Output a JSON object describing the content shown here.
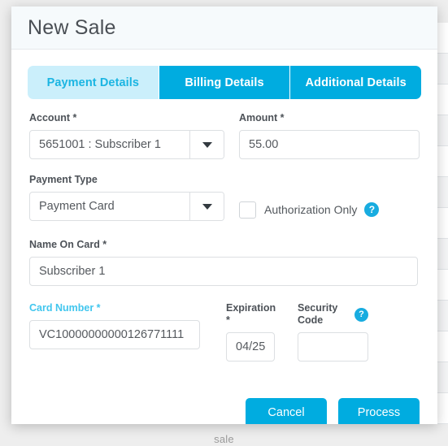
{
  "background": {
    "footer_label": "sale",
    "rows": 13
  },
  "modal": {
    "title": "New Sale",
    "tabs": [
      {
        "label": "Payment Details",
        "active": true
      },
      {
        "label": "Billing Details",
        "active": false
      },
      {
        "label": "Additional Details",
        "active": false
      }
    ],
    "fields": {
      "account": {
        "label": "Account *",
        "value": "5651001 : Subscriber 1"
      },
      "amount": {
        "label": "Amount *",
        "value": "55.00"
      },
      "payment_type": {
        "label": "Payment Type",
        "value": "Payment Card"
      },
      "authorization_only": {
        "label": "Authorization Only",
        "checked": false,
        "help_glyph": "?"
      },
      "name_on_card": {
        "label": "Name On Card *",
        "value": "Subscriber 1"
      },
      "card_number": {
        "label": "Card Number *",
        "value": "VC10000000000126771111",
        "focused": true
      },
      "expiration": {
        "label": "Expiration *",
        "value": "04/25"
      },
      "security_code": {
        "label": "Security Code",
        "value": "",
        "help_glyph": "?"
      }
    },
    "buttons": {
      "cancel": "Cancel",
      "process": "Process"
    }
  },
  "colors": {
    "accent": "#00ace0",
    "accent_light": "#cbeffb",
    "accent_text": "#1bb5e2",
    "focus_label": "#41c6ee",
    "header_bg": "#f6fafc",
    "page_bg": "#eeeeee"
  }
}
